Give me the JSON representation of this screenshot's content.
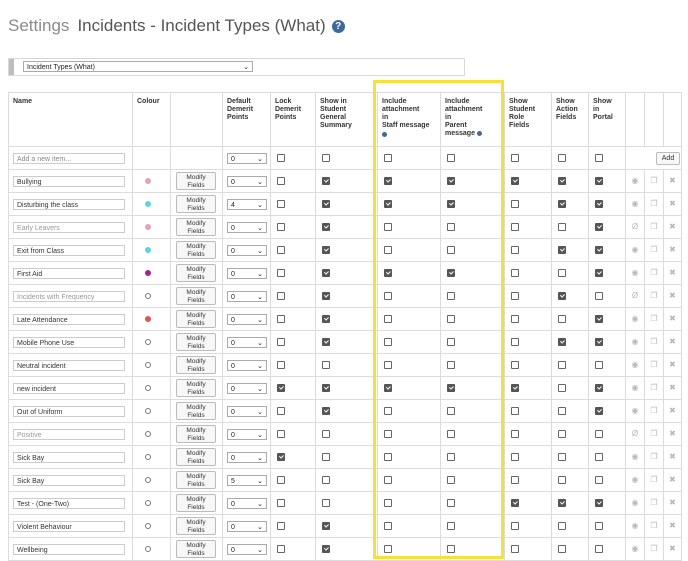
{
  "header": {
    "settings": "Settings",
    "title": "Incidents - Incident Types (What)",
    "help_icon": "?"
  },
  "selector": {
    "value": "Incident Types (What)"
  },
  "columns": {
    "name": "Name",
    "colour": "Colour",
    "demerit": [
      "Default",
      "Demerit",
      "Points"
    ],
    "lock": [
      "Lock",
      "Demerit",
      "Points"
    ],
    "summary": [
      "Show in",
      "Student",
      "General",
      "Summary"
    ],
    "staff": [
      "Include",
      "attachment",
      "in",
      "Staff message"
    ],
    "parent": [
      "Include",
      "attachment",
      "in",
      "Parent",
      "message"
    ],
    "role": [
      "Show",
      "Student",
      "Role",
      "Fields"
    ],
    "action": [
      "Show",
      "Action",
      "Fields"
    ],
    "portal": [
      "Show",
      "in",
      "Portal"
    ]
  },
  "add_row": {
    "placeholder": "Add a new item...",
    "points": "0",
    "add_label": "Add"
  },
  "modify_label": [
    "Modify",
    "Fields"
  ],
  "icons": {
    "view": "eye-icon",
    "copy": "copy-icon",
    "delete": "delete-x-icon"
  },
  "rows": [
    {
      "name": "Bullying",
      "muted": false,
      "colour": "#e8a0bc",
      "points": "0",
      "lock": false,
      "summary": true,
      "staff": true,
      "parent": true,
      "role": true,
      "action": true,
      "portal": true,
      "hidden": false
    },
    {
      "name": "Disturbing the class",
      "muted": false,
      "colour": "#5ad3e6",
      "points": "4",
      "lock": false,
      "summary": true,
      "staff": true,
      "parent": true,
      "role": false,
      "action": true,
      "portal": true,
      "hidden": false
    },
    {
      "name": "Early Leavers",
      "muted": true,
      "colour": "#e8a0bc",
      "points": "0",
      "lock": false,
      "summary": true,
      "staff": false,
      "parent": false,
      "role": false,
      "action": false,
      "portal": true,
      "hidden": true
    },
    {
      "name": "Exit from Class",
      "muted": false,
      "colour": "#5ad3e6",
      "points": "0",
      "lock": false,
      "summary": true,
      "staff": false,
      "parent": false,
      "role": false,
      "action": true,
      "portal": true,
      "hidden": false
    },
    {
      "name": "First Aid",
      "muted": false,
      "colour": "#a8238f",
      "points": "0",
      "lock": false,
      "summary": true,
      "staff": true,
      "parent": true,
      "role": false,
      "action": false,
      "portal": true,
      "hidden": false
    },
    {
      "name": "Incidents with Frequency",
      "muted": true,
      "colour": "",
      "points": "0",
      "lock": false,
      "summary": true,
      "staff": false,
      "parent": false,
      "role": false,
      "action": true,
      "portal": false,
      "hidden": true
    },
    {
      "name": "Late Attendance",
      "muted": false,
      "colour": "#e6534c",
      "points": "0",
      "lock": false,
      "summary": true,
      "staff": false,
      "parent": false,
      "role": false,
      "action": false,
      "portal": true,
      "hidden": false
    },
    {
      "name": "Mobile Phone Use",
      "muted": false,
      "colour": "",
      "points": "0",
      "lock": false,
      "summary": true,
      "staff": false,
      "parent": false,
      "role": false,
      "action": true,
      "portal": true,
      "hidden": false
    },
    {
      "name": "Neutral incident",
      "muted": false,
      "colour": "",
      "points": "0",
      "lock": false,
      "summary": false,
      "staff": false,
      "parent": false,
      "role": false,
      "action": false,
      "portal": false,
      "hidden": false
    },
    {
      "name": "new incident",
      "muted": false,
      "colour": "",
      "points": "0",
      "lock": true,
      "summary": true,
      "staff": true,
      "parent": true,
      "role": true,
      "action": false,
      "portal": true,
      "hidden": false
    },
    {
      "name": "Out of Uniform",
      "muted": false,
      "colour": "",
      "points": "0",
      "lock": false,
      "summary": true,
      "staff": false,
      "parent": false,
      "role": false,
      "action": false,
      "portal": true,
      "hidden": false
    },
    {
      "name": "Positive",
      "muted": true,
      "colour": "",
      "points": "0",
      "lock": false,
      "summary": false,
      "staff": false,
      "parent": false,
      "role": false,
      "action": false,
      "portal": false,
      "hidden": true
    },
    {
      "name": "Sick Bay",
      "muted": false,
      "colour": "",
      "points": "0",
      "lock": true,
      "summary": false,
      "staff": false,
      "parent": false,
      "role": false,
      "action": false,
      "portal": false,
      "hidden": false
    },
    {
      "name": "Sick Bay",
      "muted": false,
      "colour": "",
      "points": "5",
      "lock": false,
      "summary": false,
      "staff": false,
      "parent": false,
      "role": false,
      "action": false,
      "portal": false,
      "hidden": false
    },
    {
      "name": "Test - (One-Two)",
      "muted": false,
      "colour": "",
      "points": "0",
      "lock": false,
      "summary": false,
      "staff": false,
      "parent": false,
      "role": true,
      "action": true,
      "portal": true,
      "hidden": false
    },
    {
      "name": "Violent Behaviour",
      "muted": false,
      "colour": "",
      "points": "0",
      "lock": false,
      "summary": true,
      "staff": false,
      "parent": false,
      "role": false,
      "action": false,
      "portal": false,
      "hidden": false
    },
    {
      "name": "Wellbeing",
      "muted": false,
      "colour": "",
      "points": "0",
      "lock": false,
      "summary": true,
      "staff": false,
      "parent": false,
      "role": false,
      "action": false,
      "portal": false,
      "hidden": false
    }
  ]
}
